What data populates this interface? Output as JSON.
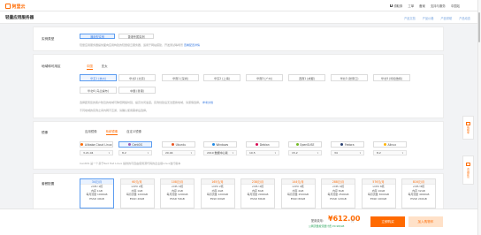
{
  "brand": {
    "logo_text": "阿里云"
  },
  "topnav": {
    "items": [
      "领取券",
      "工单",
      "备案",
      "支持与服务",
      "中国站"
    ]
  },
  "page": {
    "title": "轻量应用服务器",
    "links": [
      "产品文档",
      "产品价格",
      "产品帮助",
      "产品动态"
    ]
  },
  "instance_type": {
    "label": "实例类型",
    "options": [
      "通用型实例",
      "香港专属实例"
    ],
    "note": "轻量应用服务器提供面向应用构建的轻量级云服务器，适用于网站搭建、开发测试等场景",
    "note_link": "查看配置详情"
  },
  "region": {
    "label": "地域和可用区",
    "tabs": [
      "中国",
      "亚太"
    ],
    "regions": [
      "华东1 (杭州)",
      "华北2 (北京)",
      "华南1 (深圳)",
      "华东2 (上海)",
      "华南3 (广州)",
      "西南1 (成都)",
      "华北3 (张家口)",
      "华北5 (呼和浩特)",
      "华北6 (乌兰察布)",
      "中国 (香港)"
    ],
    "note1": "选择距离您的客户较近的地域可降低网络时延，提高访问速度。实例创建后无法更换地域，请谨慎选择。",
    "note1_link": "参考文档",
    "note2": "不同地域的实例之间内网不互通，请确认使用需求后选择。"
  },
  "image": {
    "label": "镜像",
    "tabs": [
      "应用镜像",
      "系统镜像",
      "自定义镜像"
    ],
    "os": [
      {
        "name": "Alibaba Cloud Linux",
        "color": "#ff6a00",
        "version": "3.21.04"
      },
      {
        "name": "CentOS",
        "color": "#9b59b6",
        "version": "8.2"
      },
      {
        "name": "Ubuntu",
        "color": "#e95420",
        "version": "20.04"
      },
      {
        "name": "Windows",
        "color": "#1e88e5",
        "version": "2019 数据中心版"
      },
      {
        "name": "Debian",
        "color": "#d70a53",
        "version": "10.5"
      },
      {
        "name": "OpenSUSE",
        "color": "#73ba25",
        "version": "15.2"
      },
      {
        "name": "Fedora",
        "color": "#294172",
        "version": "34"
      },
      {
        "name": "Alinux",
        "color": "#ffb300",
        "version": "8.2"
      }
    ],
    "note": "CentOS 是一个基于Red Hat Linux 提供的可自由使用源代码的企业级Linux发行版本"
  },
  "packages": {
    "label": "套餐配置",
    "cards": [
      {
        "price": "34元/月",
        "cpu": "vCPU 1核",
        "mem": "内存 1GB",
        "traffic": "每月流量 1000GB",
        "disk": "ESSD 40GB"
      },
      {
        "price": "60元/月",
        "cpu": "vCPU 2核",
        "mem": "内存 1GB",
        "traffic": "每月流量 1200GB",
        "disk": "ESSD 40GB"
      },
      {
        "price": "108元/月",
        "cpu": "vCPU 2核",
        "mem": "内存 2GB",
        "traffic": "每月流量 1200GB",
        "disk": "ESSD 50GB"
      },
      {
        "price": "165元/月",
        "cpu": "vCPU 2核",
        "mem": "内存 4GB",
        "traffic": "每月流量 1200GB",
        "disk": "ESSD 60GB"
      },
      {
        "price": "238元/月",
        "cpu": "vCPU 2核",
        "mem": "内存 8GB",
        "traffic": "每月流量 2000GB",
        "disk": "ESSD 80GB"
      },
      {
        "price": "144元/月",
        "cpu": "vCPU 4核",
        "mem": "内存 4GB",
        "traffic": "每月流量 2500GB",
        "disk": "ESSD 80GB"
      },
      {
        "price": "288元/月",
        "cpu": "vCPU 4核",
        "mem": "内存 8GB",
        "traffic": "每月流量 2500GB",
        "disk": "ESSD 120GB"
      },
      {
        "price": "576元/月",
        "cpu": "vCPU 8核",
        "mem": "内存 16GB",
        "traffic": "每月流量 3000GB",
        "disk": "ESSD 160GB"
      },
      {
        "price": "816元/月",
        "cpu": "vCPU 8核",
        "mem": "内存 32GB",
        "traffic": "每月流量 4000GB",
        "disk": "ESSD 240GB"
      }
    ]
  },
  "floatbar": [
    {
      "label": "购物车"
    },
    {
      "label": "咨询建议"
    }
  ],
  "bottom": {
    "price_label": "配置费用:",
    "price": "¥612.00",
    "price_unit": "元",
    "extra": "公网流量按流量计费 ¥0.98/GB",
    "buy": "立即购买",
    "cart": "加入购物车"
  }
}
